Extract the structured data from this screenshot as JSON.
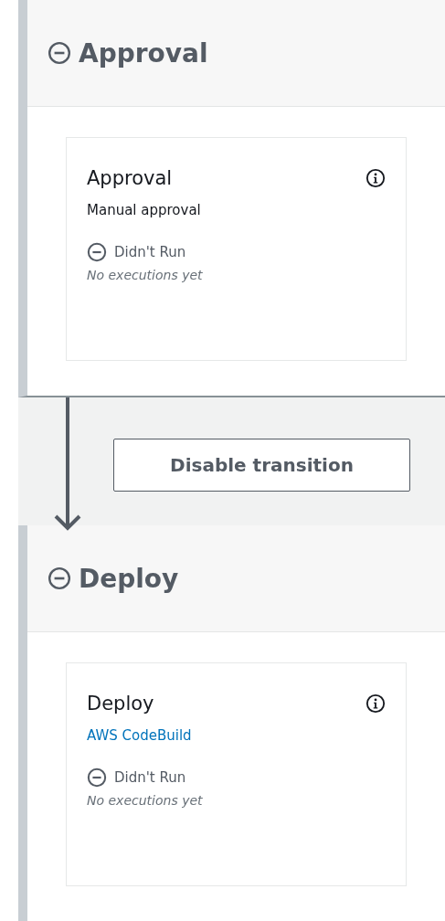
{
  "pipeline": [
    {
      "kind": "stage",
      "title": "Approval",
      "expanded": true,
      "actions": [
        {
          "name": "Approval",
          "provider": {
            "text": "Manual approval",
            "link": false
          },
          "status": {
            "kind": "didnt-run",
            "label": "Didn't Run"
          },
          "note": "No executions yet"
        }
      ]
    },
    {
      "kind": "transition",
      "button": "Disable transition"
    },
    {
      "kind": "stage",
      "title": "Deploy",
      "expanded": true,
      "actions": [
        {
          "name": "Deploy",
          "provider": {
            "text": "AWS CodeBuild",
            "link": true
          },
          "status": {
            "kind": "didnt-run",
            "label": "Didn't Run"
          },
          "note": "No executions yet"
        }
      ]
    }
  ]
}
